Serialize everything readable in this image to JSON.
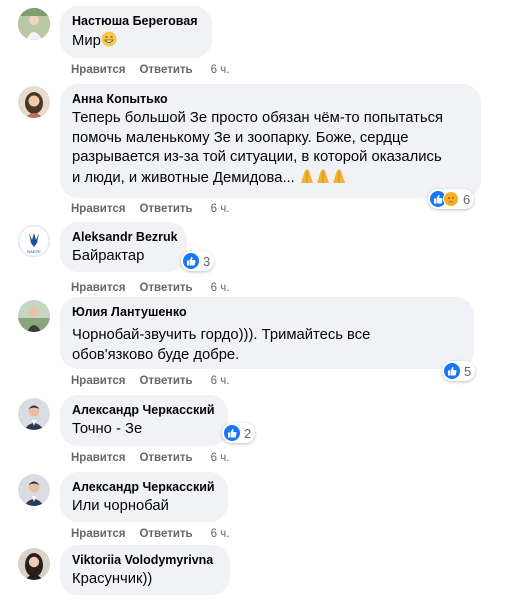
{
  "actions": {
    "like_label": "Нравится",
    "reply_label": "Ответить"
  },
  "colors": {
    "like_blue": "#1877f2",
    "bubble_bg": "#f0f2f5",
    "meta_gray": "#65676b"
  },
  "comments": [
    {
      "author": "Настюша Береговая",
      "text": "Мир",
      "emoji": "grinning-face-icon",
      "time": "6 ч."
    },
    {
      "author": "Анна Копытько",
      "text_lines": [
        "Теперь большой Зе просто обязан чём-то попытаться",
        "помочь маленькому Зе и зоопарку. Боже, сердце",
        "разрывается из-за той ситуации, в которой оказались",
        "и люди, и животные Демидова..."
      ],
      "time": "6 ч.",
      "reactions": {
        "types": [
          "like-icon",
          "care-icon"
        ],
        "count": "6"
      }
    },
    {
      "author": "Aleksandr Bezruk",
      "text": "Байрактар",
      "time": "6 ч.",
      "reactions": {
        "types": [
          "like-icon"
        ],
        "count": "3"
      }
    },
    {
      "author": "Юлия Лантушенко",
      "text_lines": [
        "Чорнобай-звучить гордо))). Тримайтесь все",
        "обов'язково буде добре."
      ],
      "time": "6 ч.",
      "reactions": {
        "types": [
          "like-icon"
        ],
        "count": "5"
      }
    },
    {
      "author": "Александр Черкасский",
      "text": "Точно - Зе",
      "time": "6 ч.",
      "reactions": {
        "types": [
          "like-icon"
        ],
        "count": "2"
      }
    },
    {
      "author": "Александр Черкасский",
      "text": "Или чорнобай",
      "time": "6 ч."
    },
    {
      "author": "Viktoriia Volodymyrivna",
      "text": "Красунчик))"
    }
  ]
}
